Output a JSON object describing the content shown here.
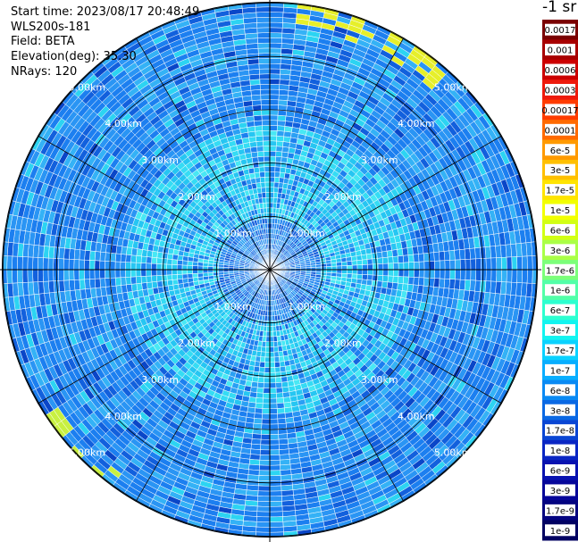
{
  "info": {
    "start_time": "Start time: 2023/08/17 20:48:49",
    "instrument": "WLS200s-181",
    "field": "Field: BETA",
    "elevation": "Elevation(deg): 35.30",
    "nrays": "NRays: 120"
  },
  "colorbar": {
    "unit": "-1 sr",
    "labels": [
      "0.0017",
      "0.001",
      "0.0006",
      "0.0003",
      "0.00017",
      "0.0001",
      "6e-5",
      "3e-5",
      "1.7e-5",
      "1e-5",
      "6e-6",
      "3e-6",
      "1.7e-6",
      "1e-6",
      "6e-7",
      "3e-7",
      "1.7e-7",
      "1e-7",
      "6e-8",
      "3e-8",
      "1.7e-8",
      "1e-8",
      "6e-9",
      "3e-9",
      "1.7e-9",
      "1e-9"
    ],
    "colors": [
      "#7a0000",
      "#a80000",
      "#cc0000",
      "#ee1a0c",
      "#ff3c00",
      "#ff6a00",
      "#ff9a00",
      "#ffc000",
      "#ffe400",
      "#f2ff00",
      "#d2ff14",
      "#aaff46",
      "#7cff7a",
      "#52ffa8",
      "#2cffd0",
      "#12f4f0",
      "#0ad2ff",
      "#08aeff",
      "#0a8af4",
      "#0a68e4",
      "#0a46d4",
      "#0a26c4",
      "#0812b0",
      "#06069a",
      "#040480",
      "#020262"
    ]
  },
  "range_rings": {
    "labels": [
      "1.00km",
      "2.00km",
      "3.00km",
      "4.00km",
      "5.00km"
    ]
  }
}
